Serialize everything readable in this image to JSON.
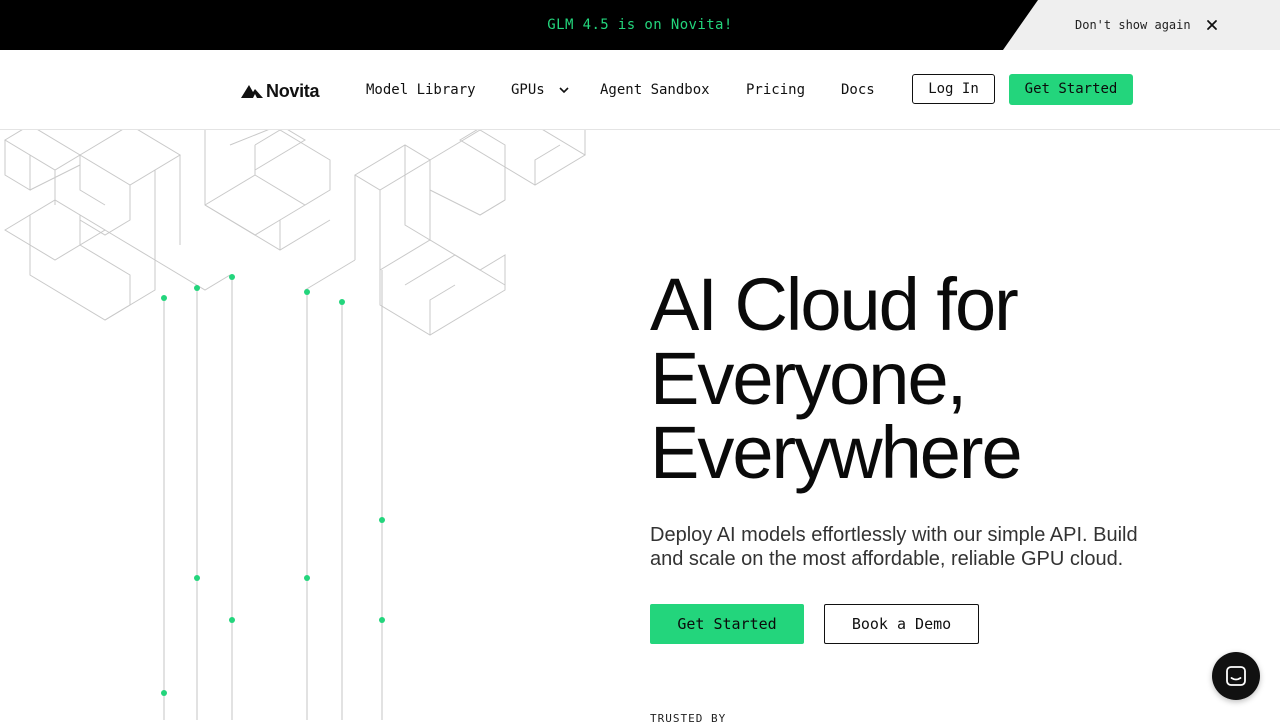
{
  "banner": {
    "message": "GLM 4.5 is on Novita!",
    "dismiss_label": "Don't show again",
    "close_icon": "close-icon"
  },
  "nav": {
    "logo_text": "Novita",
    "items": [
      {
        "label": "Model Library"
      },
      {
        "label": "GPUs",
        "icon": "chevron-down-icon"
      },
      {
        "label": "Agent Sandbox"
      },
      {
        "label": "Pricing"
      },
      {
        "label": "Docs"
      }
    ],
    "login_label": "Log In",
    "get_started_label": "Get Started"
  },
  "hero": {
    "title_lines": [
      "AI Cloud for",
      "Everyone,",
      "Everywhere"
    ],
    "subtitle": "Deploy AI models effortlessly with our simple API. Build and scale on the most affordable, reliable GPU cloud.",
    "primary_cta": "Get Started",
    "secondary_cta": "Book a Demo",
    "trusted_by_label": "TRUSTED BY"
  },
  "chat_widget": {
    "icon": "chat-icon"
  },
  "colors": {
    "accent": "#23d57c",
    "banner_bg": "#000000",
    "banner_right_bg": "#efefef",
    "text": "#111111"
  }
}
